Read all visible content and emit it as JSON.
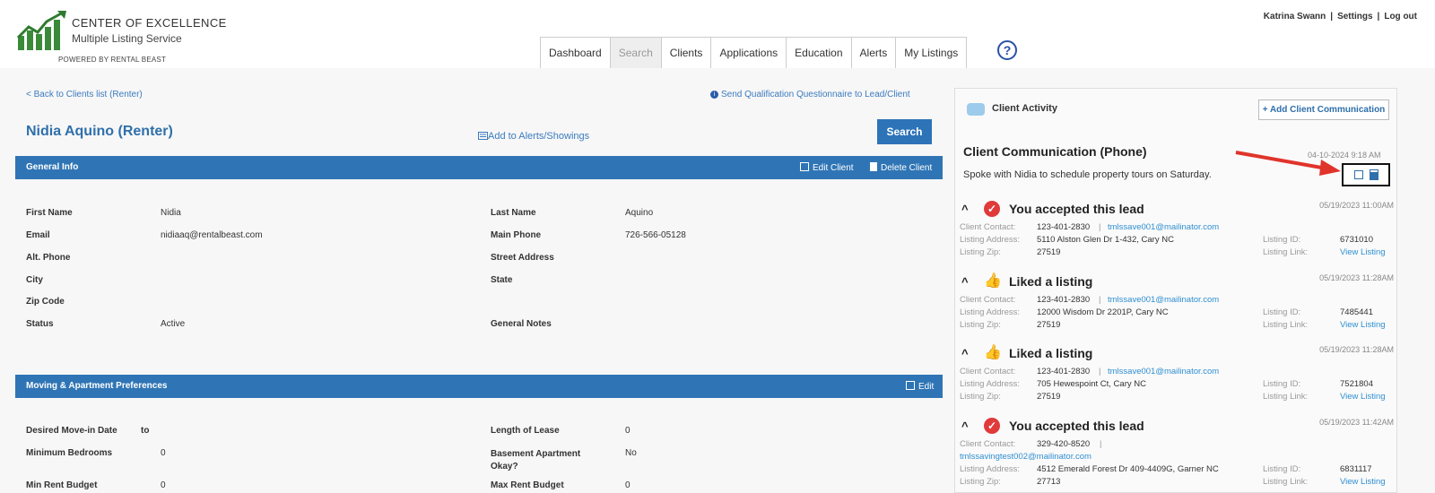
{
  "header": {
    "logo_line1": "CENTER OF EXCELLENCE",
    "logo_line2": "Multiple Listing Service",
    "logo_powered": "POWERED BY RENTAL BEAST",
    "user_name": "Katrina Swann",
    "settings": "Settings",
    "logout": "Log out",
    "help_glyph": "?",
    "tabs": [
      {
        "label": "Dashboard"
      },
      {
        "label": "Search"
      },
      {
        "label": "Clients"
      },
      {
        "label": "Applications"
      },
      {
        "label": "Education"
      },
      {
        "label": "Alerts"
      },
      {
        "label": "My Listings"
      }
    ],
    "active_tab": "Search"
  },
  "client": {
    "back_link": "< Back to Clients list (Renter)",
    "send_questionnaire": "Send Qualification Questionnaire to Lead/Client",
    "name": "Nidia Aquino (Renter)",
    "add_alerts": "Add to Alerts/Showings",
    "search_button": "Search"
  },
  "general_info": {
    "title": "General Info",
    "edit_label": "Edit Client",
    "delete_label": "Delete Client",
    "left": [
      {
        "label": "First Name",
        "value": "Nidia"
      },
      {
        "label": "Email",
        "value": "nidiaaq@rentalbeast.com"
      },
      {
        "label": "Alt. Phone",
        "value": ""
      },
      {
        "label": "City",
        "value": ""
      },
      {
        "label": "Zip Code",
        "value": ""
      },
      {
        "label": "Status",
        "value": "Active"
      }
    ],
    "right": [
      {
        "label": "Last Name",
        "value": "Aquino"
      },
      {
        "label": "Main Phone",
        "value": "726-566-05128"
      },
      {
        "label": "Street Address",
        "value": ""
      },
      {
        "label": "State",
        "value": ""
      },
      {
        "label": "General Notes",
        "value": ""
      }
    ]
  },
  "preferences": {
    "title": "Moving & Apartment Preferences",
    "edit_label": "Edit",
    "left": [
      {
        "label": "Desired Move-in Date",
        "value": "to"
      },
      {
        "label": "Minimum Bedrooms",
        "value": "0"
      },
      {
        "label": "Min Rent Budget",
        "value": "0"
      }
    ],
    "right": [
      {
        "label": "Length of Lease",
        "value": "0"
      },
      {
        "label": "Basement Apartment Okay?",
        "value": "No"
      },
      {
        "label": "Max Rent Budget",
        "value": "0"
      }
    ]
  },
  "activity": {
    "title": "Client Activity",
    "add_button": "+ Add Client Communication",
    "communication": {
      "title": "Client Communication (Phone)",
      "date": "04-10-2024 9:18 AM",
      "text": "Spoke with Nidia to schedule property tours on Saturday."
    },
    "labels": {
      "contact": "Client Contact:",
      "address": "Listing Address:",
      "zip": "Listing Zip:",
      "listing_id": "Listing ID:",
      "listing_link": "Listing Link:",
      "view_listing": "View Listing"
    },
    "items": [
      {
        "type": "accepted",
        "title": "You accepted this lead",
        "date": "05/19/2023 11:00AM",
        "phone": "123-401-2830",
        "email": "tmlssave001@mailinator.com",
        "address": "5110 Alston Glen Dr 1-432, Cary NC",
        "zip": "27519",
        "listing_id": "6731010"
      },
      {
        "type": "liked",
        "title": "Liked a listing",
        "date": "05/19/2023 11:28AM",
        "phone": "123-401-2830",
        "email": "tmlssave001@mailinator.com",
        "address": "12000 Wisdom Dr 2201P, Cary NC",
        "zip": "27519",
        "listing_id": "7485441"
      },
      {
        "type": "liked",
        "title": "Liked a listing",
        "date": "05/19/2023 11:28AM",
        "phone": "123-401-2830",
        "email": "tmlssave001@mailinator.com",
        "address": "705 Hewespoint Ct, Cary NC",
        "zip": "27519",
        "listing_id": "7521804"
      },
      {
        "type": "accepted",
        "title": "You accepted this lead",
        "date": "05/19/2023 11:42AM",
        "phone": "329-420-8520",
        "email": "tmlssavingtest002@mailinator.com",
        "address": "4512 Emerald Forest Dr 409-4409G, Garner NC",
        "zip": "27713",
        "listing_id": "6831117"
      }
    ]
  }
}
